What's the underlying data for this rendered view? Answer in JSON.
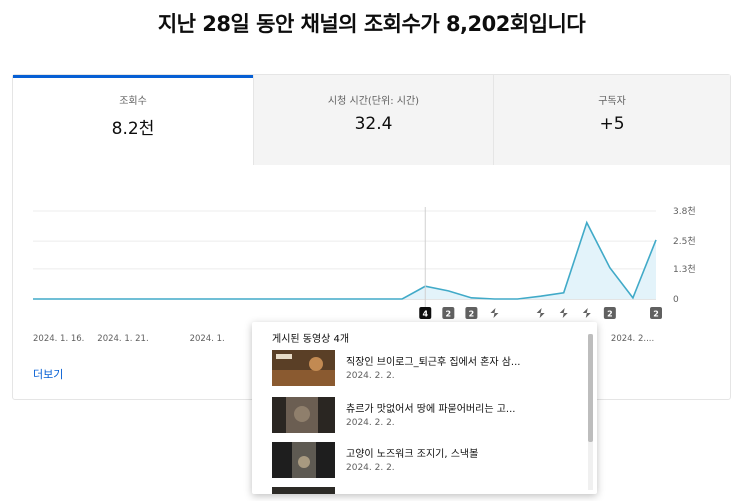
{
  "headline": "지난 28일 동안 채널의 조회수가 8,202회입니다",
  "tabs": [
    {
      "label": "조회수",
      "value": "8.2천"
    },
    {
      "label": "시청 시간(단위: 시간)",
      "value": "32.4"
    },
    {
      "label": "구독자",
      "value": "+5"
    }
  ],
  "chart_data": {
    "type": "area",
    "title": "",
    "xlabel": "",
    "ylabel": "",
    "y_tick_labels": [
      "3.8천",
      "2.5천",
      "1.3천",
      "0"
    ],
    "y_ticks": [
      3800,
      2500,
      1300,
      0
    ],
    "ylim": [
      0,
      3800
    ],
    "x_tick_labels": [
      "2024. 1. 16.",
      "2024. 1. 21.",
      "2024. 1.",
      "2024. 2...."
    ],
    "series": [
      {
        "values": [
          0,
          0,
          0,
          0,
          0,
          0,
          0,
          0,
          0,
          0,
          0,
          0,
          0,
          0,
          0,
          0,
          0,
          550,
          350,
          50,
          0,
          0,
          120,
          270,
          3300,
          1350,
          50,
          2550
        ]
      }
    ],
    "colors": {
      "line": "#41aac8",
      "fill": "#e3f3fa"
    },
    "markers": [
      {
        "index": 17,
        "kind": "count",
        "label": "4",
        "dark": true
      },
      {
        "index": 18,
        "kind": "count",
        "label": "2",
        "dark": false
      },
      {
        "index": 19,
        "kind": "count",
        "label": "2",
        "dark": false
      },
      {
        "index": 20,
        "kind": "short",
        "label": "",
        "dark": false
      },
      {
        "index": 22,
        "kind": "short",
        "label": "",
        "dark": false
      },
      {
        "index": 23,
        "kind": "short",
        "label": "",
        "dark": false
      },
      {
        "index": 24,
        "kind": "short",
        "label": "",
        "dark": false
      },
      {
        "index": 25,
        "kind": "count",
        "label": "2",
        "dark": false
      },
      {
        "index": 27,
        "kind": "count",
        "label": "2",
        "dark": false
      }
    ]
  },
  "more_link": "더보기",
  "popup": {
    "title": "게시된 동영상 4개",
    "videos": [
      {
        "title": "직장인 브이로그_퇴근후 집에서 혼자 삼...",
        "date": "2024. 2. 2."
      },
      {
        "title": "츄르가 맛없어서 땅에 파묻어버리는 고...",
        "date": "2024. 2. 2."
      },
      {
        "title": "고양이 노즈워크 조지기, 스낵볼",
        "date": "2024. 2. 2."
      },
      {
        "title": "",
        "date": ""
      }
    ]
  }
}
